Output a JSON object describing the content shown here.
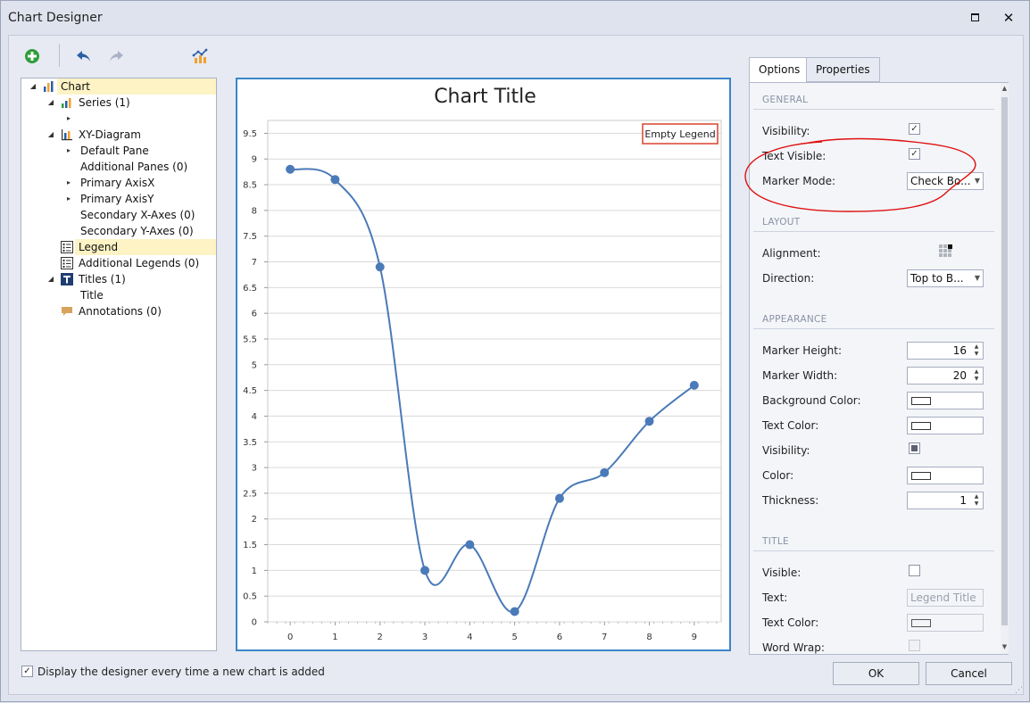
{
  "window": {
    "title": "Chart Designer",
    "maximize_icon": "maximize-icon",
    "close_label": "✕"
  },
  "toolbar": {
    "add_icon": "add-icon",
    "undo_icon": "undo-icon",
    "redo_icon": "redo-icon",
    "chart_wizard_icon": "chart-type-icon"
  },
  "tree": {
    "items": [
      {
        "label": "Chart",
        "level": 0,
        "expander": "◢",
        "icon": "chart-bar-icon",
        "selected": true
      },
      {
        "label": "Series (1)",
        "level": 1,
        "expander": "◢",
        "icon": "series-icon"
      },
      {
        "label": "",
        "level": 2,
        "expander": "▸",
        "icon": ""
      },
      {
        "label": "XY-Diagram",
        "level": 1,
        "expander": "◢",
        "icon": "diagram-icon"
      },
      {
        "label": "Default Pane",
        "level": 2,
        "expander": "▸",
        "icon": ""
      },
      {
        "label": "Additional Panes (0)",
        "level": 2,
        "expander": "",
        "icon": ""
      },
      {
        "label": "Primary AxisX",
        "level": 2,
        "expander": "▸",
        "icon": ""
      },
      {
        "label": "Primary AxisY",
        "level": 2,
        "expander": "▸",
        "icon": ""
      },
      {
        "label": "Secondary X-Axes (0)",
        "level": 2,
        "expander": "",
        "icon": ""
      },
      {
        "label": "Secondary Y-Axes (0)",
        "level": 2,
        "expander": "",
        "icon": ""
      },
      {
        "label": "Legend",
        "level": 1,
        "expander": "",
        "icon": "legend-icon",
        "highlight": true
      },
      {
        "label": "Additional Legends (0)",
        "level": 1,
        "expander": "",
        "icon": "legend-icon"
      },
      {
        "label": "Titles (1)",
        "level": 1,
        "expander": "◢",
        "icon": "title-icon"
      },
      {
        "label": "Title",
        "level": 2,
        "expander": "",
        "icon": ""
      },
      {
        "label": "Annotations (0)",
        "level": 1,
        "expander": "",
        "icon": "annotation-icon"
      }
    ]
  },
  "chart_data": {
    "type": "line",
    "title": "Chart Title",
    "legend_text": "Empty Legend",
    "legend_position": "top-right",
    "x": [
      0,
      1,
      2,
      3,
      4,
      5,
      6,
      7,
      8,
      9
    ],
    "series": [
      {
        "values": [
          8.8,
          8.6,
          6.9,
          1.0,
          1.5,
          0.2,
          2.4,
          2.9,
          3.9,
          4.6
        ]
      }
    ],
    "xlim": [
      -0.5,
      9.6
    ],
    "ylim": [
      0,
      9.75
    ],
    "yticks": [
      0,
      0.5,
      1,
      1.5,
      2,
      2.5,
      3,
      3.5,
      4,
      4.5,
      5,
      5.5,
      6,
      6.5,
      7,
      7.5,
      8,
      8.5,
      9,
      9.5
    ],
    "xticks": [
      0,
      1,
      2,
      3,
      4,
      5,
      6,
      7,
      8,
      9
    ],
    "grid": true,
    "color": "#4a7ab8",
    "smooth": true
  },
  "tabs": [
    {
      "label": "Options",
      "active": true
    },
    {
      "label": "Properties",
      "active": false
    }
  ],
  "options": {
    "general": {
      "title": "GENERAL",
      "visibility_label": "Visibility:",
      "visibility_checked": true,
      "text_visible_label": "Text Visible:",
      "text_visible_checked": true,
      "marker_mode_label": "Marker Mode:",
      "marker_mode_value": "Check Bo..."
    },
    "layout": {
      "title": "LAYOUT",
      "alignment_label": "Alignment:",
      "alignment_icon": "alignment-grid-icon",
      "direction_label": "Direction:",
      "direction_value": "Top to B..."
    },
    "appearance": {
      "title": "APPEARANCE",
      "marker_height_label": "Marker Height:",
      "marker_height_value": "16",
      "marker_width_label": "Marker Width:",
      "marker_width_value": "20",
      "background_color_label": "Background Color:",
      "text_color_label": "Text Color:",
      "visibility_label": "Visibility:",
      "visibility_state": "indeterminate",
      "color_label": "Color:",
      "thickness_label": "Thickness:",
      "thickness_value": "1"
    },
    "title_section": {
      "title": "TITLE",
      "visible_label": "Visible:",
      "visible_checked": false,
      "text_label": "Text:",
      "text_placeholder": "Legend Title",
      "text_color_label": "Text Color:",
      "word_wrap_label": "Word Wrap:",
      "word_wrap_checked": false
    }
  },
  "footer": {
    "show_designer_checked": true,
    "show_designer_label": "Display the designer every time a new chart is added",
    "ok_label": "OK",
    "cancel_label": "Cancel"
  },
  "annotation_color": "#e01010"
}
